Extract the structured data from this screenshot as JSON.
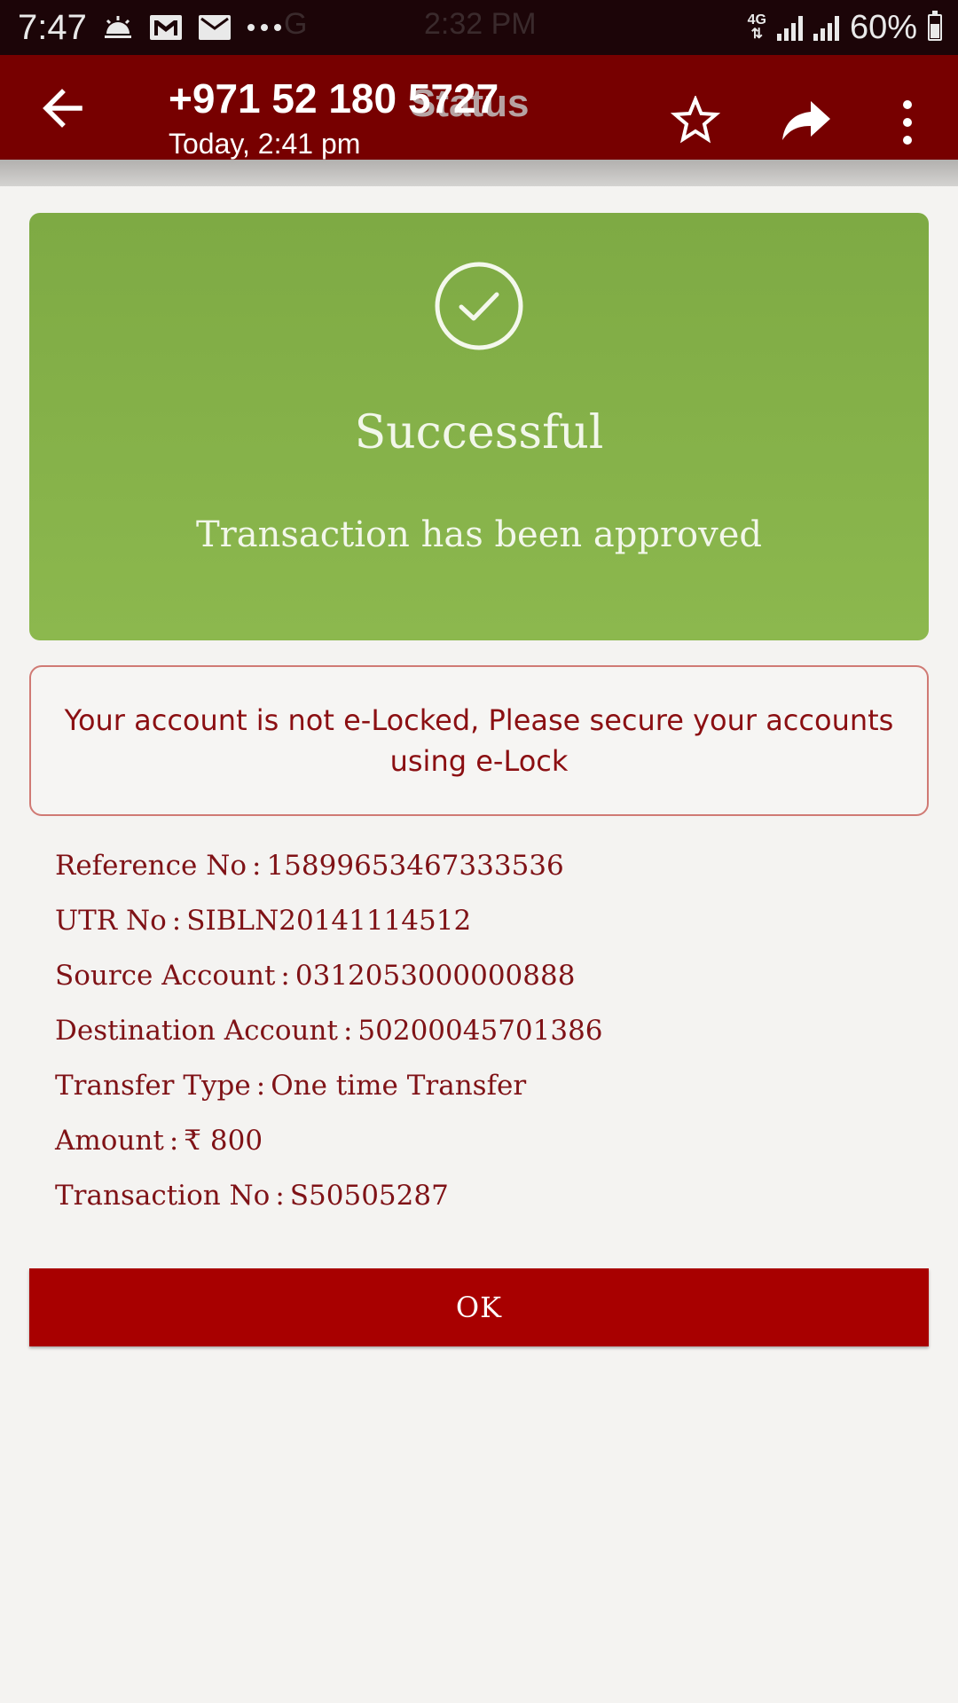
{
  "status_bar": {
    "time": "7:47",
    "ghost_left": "G",
    "ghost_center": "2:32 PM",
    "network": "4G",
    "battery": "60%"
  },
  "app_bar": {
    "title": "+971 52 180 5727",
    "subtitle": "Today, 2:41 pm",
    "ghost_title": "Status"
  },
  "success": {
    "title": "Successful",
    "message": "Transaction has been approved"
  },
  "warning": {
    "text": "Your account is not e-Locked, Please secure your accounts using e-Lock"
  },
  "details": [
    {
      "label": "Reference No",
      "value": "15899653467333536"
    },
    {
      "label": "UTR No",
      "value": "SIBLN20141114512"
    },
    {
      "label": "Source Account",
      "value": "0312053000000888"
    },
    {
      "label": "Destination Account",
      "value": "50200045701386"
    },
    {
      "label": "Transfer Type",
      "value": "One time Transfer"
    },
    {
      "label": "Amount",
      "value": "₹ 800"
    },
    {
      "label": "Transaction No",
      "value": "S50505287"
    }
  ],
  "ok_label": "OK",
  "colors": {
    "app_bar": "#770000",
    "success": "#86b34a",
    "warning_border": "#d07a74",
    "text_red": "#7f1216",
    "button": "#a80000"
  }
}
